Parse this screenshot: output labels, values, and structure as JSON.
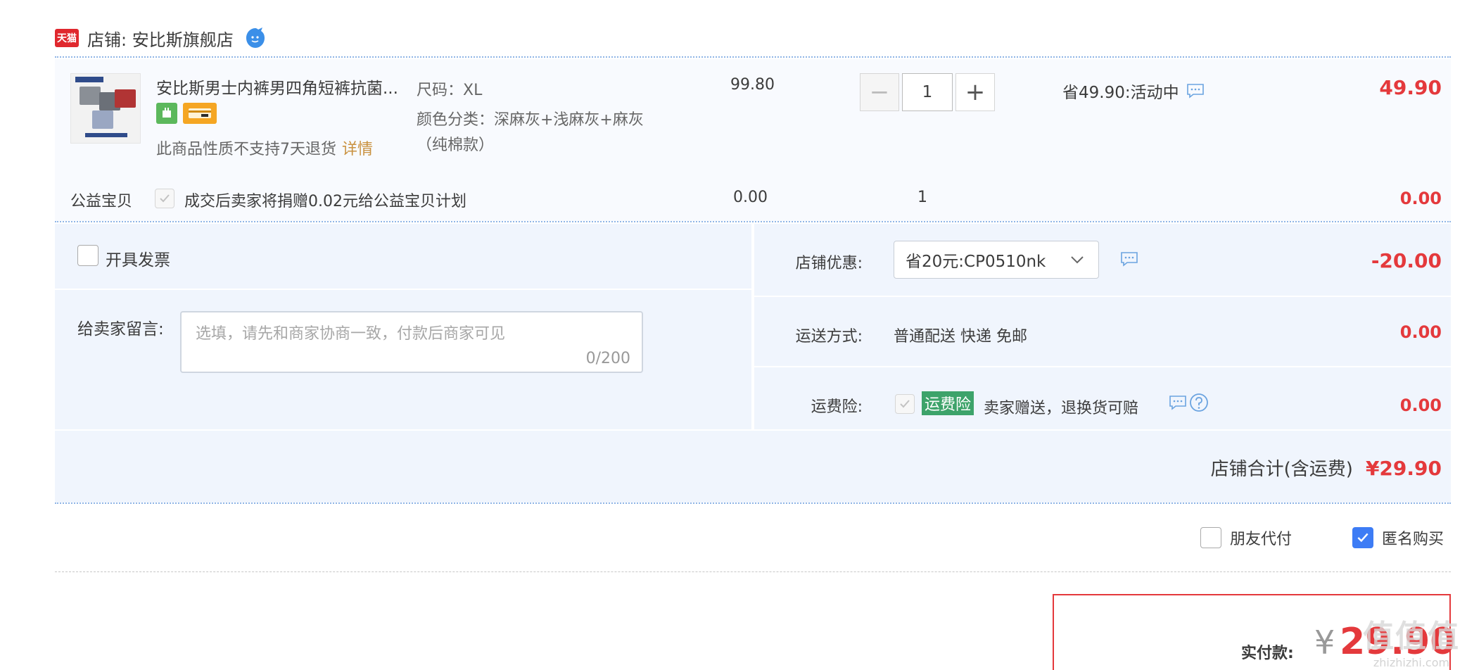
{
  "shop": {
    "tmall_badge": "天猫",
    "label": "店铺: 安比斯旗舰店"
  },
  "item": {
    "title": "安比斯男士内裤男四角短裤抗菌...",
    "no_return_text": "此商品性质不支持7天退货",
    "detail_link": "详情",
    "sku_size": "尺码：XL",
    "sku_color": "颜色分类：深麻灰+浅麻灰+麻灰",
    "sku_color_line2": "（纯棉款）",
    "price": "99.80",
    "quantity": "1",
    "minus_label": "−",
    "plus_label": "+",
    "promo_text": "省49.90:活动中",
    "total": "49.90"
  },
  "charity": {
    "label": "公益宝贝",
    "text": "成交后卖家将捐赠0.02元给公益宝贝计划",
    "price": "0.00",
    "quantity": "1",
    "total": "0.00"
  },
  "invoice": {
    "label": "开具发票"
  },
  "message": {
    "label": "给卖家留言:",
    "placeholder": "选填，请先和商家协商一致，付款后商家可见",
    "count": "0/200"
  },
  "coupon": {
    "label": "店铺优惠:",
    "selected": "省20元:CP0510nk",
    "amount": "-20.00"
  },
  "shipping": {
    "label": "运送方式:",
    "text": "普通配送 快递 免邮",
    "amount": "0.00"
  },
  "insurance": {
    "label": "运费险:",
    "tag": "运费险",
    "text": "卖家赠送，退换货可赔",
    "amount": "0.00"
  },
  "subtotal": {
    "label": "店铺合计(含运费)",
    "amount": "¥29.90"
  },
  "options": {
    "friend_pay": "朋友代付",
    "anonymous": "匿名购买"
  },
  "payment": {
    "label": "实付款:",
    "currency": "¥",
    "amount": "29.90"
  },
  "watermark": {
    "big": "值值值",
    "small": "zhizhizhi.com"
  },
  "colors": {
    "accent_red": "#e4393c",
    "check_blue": "#3d7cf5",
    "panel_bg": "#f0f5fd",
    "tag_green": "#3da36a"
  }
}
